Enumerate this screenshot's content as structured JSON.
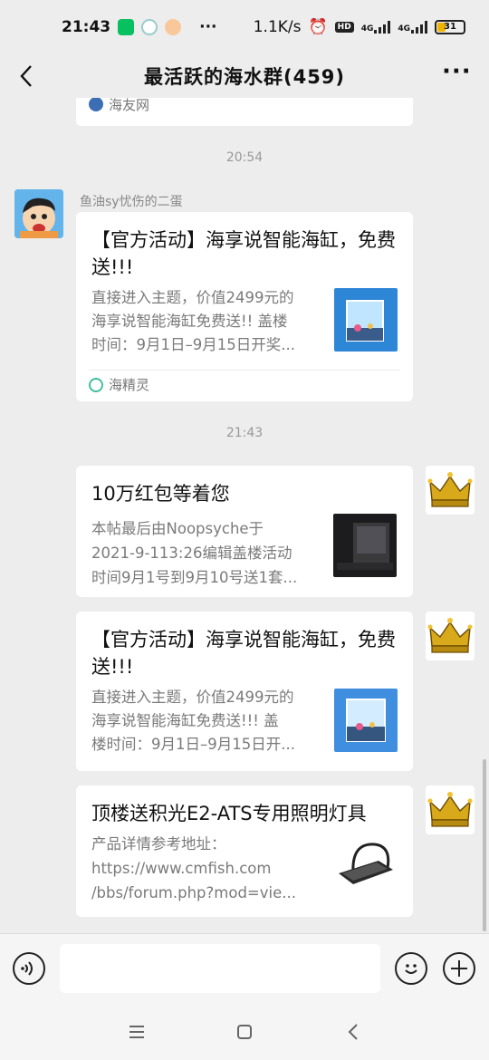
{
  "status_bar": {
    "time": "21:43",
    "dots": "···",
    "net_speed": "1.1K/s",
    "hd": "HD",
    "net1": "4G",
    "net2": "4G",
    "battery": "31",
    "battery_level_percent": 31
  },
  "header": {
    "title": "最活跃的海水群(459)",
    "more": "···"
  },
  "messages": {
    "prev_card": {
      "source": "海友网"
    },
    "time1": "20:54",
    "msg1": {
      "sender": "鱼油sy忧伤的二蛋",
      "title": "【官方活动】海享说智能海缸，免费送!!!",
      "desc1": "直接进入主题，价值2499元的",
      "desc2": "海享说智能海缸免费送!! 盖楼",
      "desc3": "时间：9月1日–9月15日开奖...",
      "source": "海精灵"
    },
    "time2": "21:43",
    "msg2": {
      "title": "10万红包等着您",
      "desc1": "本帖最后由Noopsyche于",
      "desc2": "2021-9-113:26编辑盖楼活动",
      "desc3": "时间9月1号到9月10号送1套..."
    },
    "msg3": {
      "title": "【官方活动】海享说智能海缸，免费送!!!",
      "desc1": "直接进入主题，价值2499元的",
      "desc2": "海享说智能海缸免费送!!! 盖",
      "desc3": "楼时间：9月1日–9月15日开..."
    },
    "msg4": {
      "title": "顶楼送积光E2-ATS专用照明灯具",
      "desc1": "产品详情参考地址：",
      "desc2": "https://www.cmfish.com",
      "desc3": "/bbs/forum.php?mod=vie..."
    }
  },
  "colors": {
    "background": "#ededed",
    "card": "#ffffff",
    "wechat_green": "#07c160",
    "battery": "#f0b400"
  },
  "icons": [
    "back-arrow-icon",
    "more-dots-icon",
    "voice-icon",
    "emoji-icon",
    "plus-icon",
    "menu-icon",
    "home-icon",
    "back-nav-icon",
    "crown-icon"
  ]
}
